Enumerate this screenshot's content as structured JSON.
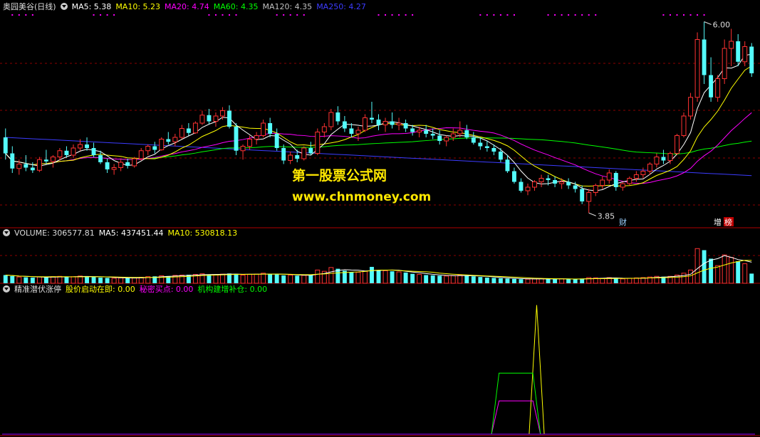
{
  "colors": {
    "bg": "#000000",
    "up": "#ff3232",
    "down": "#54fcfc",
    "ma5": "#ffffff",
    "ma10": "#ffff00",
    "ma20": "#ff00ff",
    "ma60": "#00ff00",
    "ma120": "#c0c0c0",
    "ma250": "#3c3cff",
    "grid": "#8b0000",
    "vma5": "#ffffff",
    "vma10": "#ffff00",
    "ind1": "#ffff00",
    "ind2": "#ff00ff",
    "ind3": "#00ff00"
  },
  "main": {
    "title": "奥园美谷(日线)",
    "ma": [
      {
        "text": "MA5: 5.38",
        "color": "#ffffff"
      },
      {
        "text": "MA10: 5.23",
        "color": "#ffff00"
      },
      {
        "text": "MA20: 4.74",
        "color": "#ff00ff"
      },
      {
        "text": "MA60: 4.35",
        "color": "#00ff00"
      },
      {
        "text": "MA120: 4.35",
        "color": "#c0c0c0"
      },
      {
        "text": "MA250: 4.27",
        "color": "#3c3cff"
      }
    ],
    "high_label": "6.00",
    "low_label": "3.85",
    "marker_cai": "财",
    "marker_zeng": "增",
    "marker_bang": "榜"
  },
  "volume": {
    "items": [
      {
        "text": "VOLUME: 306577.81",
        "color": "#dddddd"
      },
      {
        "text": "MA5: 437451.44",
        "color": "#ffffff"
      },
      {
        "text": "MA10: 530818.13",
        "color": "#ffff00"
      }
    ]
  },
  "indicator": {
    "name": "精准潜伏涨停",
    "items": [
      {
        "text": "股价启动在即: 0.00",
        "color": "#ffff00"
      },
      {
        "text": "秘密买点: 0.00",
        "color": "#ff00ff"
      },
      {
        "text": "机构建增补仓: 0.00",
        "color": "#00ff00"
      }
    ]
  },
  "watermark": {
    "line1": "第一股票公式网",
    "line2": "www.chnmoney.com"
  },
  "chart_data": {
    "type": "candlestick",
    "price_range": [
      3.7,
      6.1
    ],
    "ma250_start": 4.7,
    "ma250_end": 4.27,
    "ohlc": [
      [
        4.7,
        4.8,
        4.45,
        4.52
      ],
      [
        4.52,
        4.6,
        4.3,
        4.35
      ],
      [
        4.35,
        4.45,
        4.28,
        4.4
      ],
      [
        4.4,
        4.5,
        4.32,
        4.36
      ],
      [
        4.36,
        4.42,
        4.3,
        4.33
      ],
      [
        4.33,
        4.48,
        4.31,
        4.45
      ],
      [
        4.45,
        4.56,
        4.4,
        4.43
      ],
      [
        4.43,
        4.5,
        4.36,
        4.48
      ],
      [
        4.48,
        4.58,
        4.44,
        4.55
      ],
      [
        4.55,
        4.6,
        4.47,
        4.5
      ],
      [
        4.5,
        4.62,
        4.47,
        4.58
      ],
      [
        4.58,
        4.68,
        4.55,
        4.62
      ],
      [
        4.62,
        4.7,
        4.55,
        4.58
      ],
      [
        4.58,
        4.64,
        4.48,
        4.5
      ],
      [
        4.5,
        4.55,
        4.4,
        4.42
      ],
      [
        4.42,
        4.46,
        4.3,
        4.34
      ],
      [
        4.34,
        4.4,
        4.28,
        4.36
      ],
      [
        4.36,
        4.45,
        4.32,
        4.42
      ],
      [
        4.42,
        4.46,
        4.35,
        4.38
      ],
      [
        4.38,
        4.48,
        4.36,
        4.46
      ],
      [
        4.46,
        4.58,
        4.44,
        4.55
      ],
      [
        4.55,
        4.62,
        4.5,
        4.6
      ],
      [
        4.6,
        4.65,
        4.52,
        4.56
      ],
      [
        4.56,
        4.7,
        4.55,
        4.68
      ],
      [
        4.68,
        4.76,
        4.62,
        4.65
      ],
      [
        4.65,
        4.74,
        4.6,
        4.7
      ],
      [
        4.7,
        4.84,
        4.68,
        4.8
      ],
      [
        4.8,
        4.86,
        4.72,
        4.75
      ],
      [
        4.75,
        4.88,
        4.74,
        4.86
      ],
      [
        4.86,
        5.0,
        4.84,
        4.95
      ],
      [
        4.95,
        5.02,
        4.85,
        4.88
      ],
      [
        4.88,
        4.98,
        4.82,
        4.94
      ],
      [
        4.94,
        5.04,
        4.9,
        5.0
      ],
      [
        5.0,
        5.06,
        4.8,
        4.82
      ],
      [
        4.82,
        4.86,
        4.5,
        4.55
      ],
      [
        4.55,
        4.62,
        4.45,
        4.6
      ],
      [
        4.6,
        4.72,
        4.56,
        4.68
      ],
      [
        4.68,
        4.76,
        4.62,
        4.72
      ],
      [
        4.72,
        4.9,
        4.7,
        4.86
      ],
      [
        4.86,
        4.92,
        4.7,
        4.74
      ],
      [
        4.74,
        4.8,
        4.55,
        4.58
      ],
      [
        4.58,
        4.62,
        4.4,
        4.44
      ],
      [
        4.44,
        4.54,
        4.4,
        4.5
      ],
      [
        4.5,
        4.56,
        4.42,
        4.46
      ],
      [
        4.46,
        4.6,
        4.44,
        4.58
      ],
      [
        4.58,
        4.65,
        4.5,
        4.52
      ],
      [
        4.52,
        4.8,
        4.5,
        4.76
      ],
      [
        4.76,
        4.86,
        4.7,
        4.82
      ],
      [
        4.82,
        5.02,
        4.78,
        4.98
      ],
      [
        4.98,
        5.05,
        4.84,
        4.88
      ],
      [
        4.88,
        4.94,
        4.76,
        4.8
      ],
      [
        4.8,
        4.86,
        4.7,
        4.74
      ],
      [
        4.74,
        4.82,
        4.66,
        4.78
      ],
      [
        4.78,
        4.96,
        4.76,
        4.92
      ],
      [
        4.92,
        5.1,
        4.86,
        4.9
      ],
      [
        4.9,
        4.96,
        4.78,
        4.84
      ],
      [
        4.84,
        4.92,
        4.76,
        4.88
      ],
      [
        4.88,
        4.98,
        4.8,
        4.84
      ],
      [
        4.84,
        4.92,
        4.78,
        4.86
      ],
      [
        4.86,
        4.9,
        4.76,
        4.8
      ],
      [
        4.8,
        4.84,
        4.72,
        4.76
      ],
      [
        4.76,
        4.82,
        4.7,
        4.78
      ],
      [
        4.78,
        4.84,
        4.7,
        4.74
      ],
      [
        4.74,
        4.8,
        4.68,
        4.72
      ],
      [
        4.72,
        4.78,
        4.62,
        4.66
      ],
      [
        4.66,
        4.72,
        4.6,
        4.7
      ],
      [
        4.7,
        4.8,
        4.66,
        4.74
      ],
      [
        4.74,
        4.88,
        4.7,
        4.78
      ],
      [
        4.78,
        4.84,
        4.68,
        4.7
      ],
      [
        4.7,
        4.76,
        4.62,
        4.64
      ],
      [
        4.64,
        4.7,
        4.56,
        4.6
      ],
      [
        4.6,
        4.66,
        4.54,
        4.58
      ],
      [
        4.58,
        4.62,
        4.5,
        4.54
      ],
      [
        4.54,
        4.58,
        4.42,
        4.45
      ],
      [
        4.45,
        4.5,
        4.3,
        4.32
      ],
      [
        4.32,
        4.36,
        4.18,
        4.2
      ],
      [
        4.2,
        4.24,
        4.08,
        4.1
      ],
      [
        4.1,
        4.18,
        4.05,
        4.14
      ],
      [
        4.14,
        4.22,
        4.1,
        4.2
      ],
      [
        4.2,
        4.28,
        4.14,
        4.24
      ],
      [
        4.24,
        4.28,
        4.16,
        4.22
      ],
      [
        4.22,
        4.26,
        4.14,
        4.18
      ],
      [
        4.18,
        4.24,
        4.12,
        4.2
      ],
      [
        4.2,
        4.24,
        4.12,
        4.16
      ],
      [
        4.16,
        4.2,
        4.08,
        4.12
      ],
      [
        4.12,
        4.16,
        3.95,
        3.98
      ],
      [
        3.98,
        4.12,
        3.85,
        4.08
      ],
      [
        4.08,
        4.18,
        4.04,
        4.16
      ],
      [
        4.16,
        4.26,
        4.12,
        4.22
      ],
      [
        4.22,
        4.34,
        4.18,
        4.3
      ],
      [
        4.3,
        4.32,
        4.1,
        4.14
      ],
      [
        4.14,
        4.2,
        4.1,
        4.18
      ],
      [
        4.18,
        4.26,
        4.16,
        4.24
      ],
      [
        4.24,
        4.32,
        4.2,
        4.28
      ],
      [
        4.28,
        4.36,
        4.24,
        4.32
      ],
      [
        4.32,
        4.42,
        4.28,
        4.4
      ],
      [
        4.4,
        4.52,
        4.36,
        4.48
      ],
      [
        4.48,
        4.56,
        4.4,
        4.44
      ],
      [
        4.44,
        4.54,
        4.4,
        4.52
      ],
      [
        4.52,
        4.74,
        4.5,
        4.72
      ],
      [
        4.72,
        4.98,
        4.7,
        4.94
      ],
      [
        4.94,
        5.2,
        4.9,
        5.15
      ],
      [
        5.15,
        5.88,
        5.1,
        5.8
      ],
      [
        5.8,
        6.0,
        5.3,
        5.4
      ],
      [
        5.4,
        5.6,
        5.1,
        5.15
      ],
      [
        5.15,
        5.4,
        5.1,
        5.36
      ],
      [
        5.36,
        5.8,
        5.3,
        5.7
      ],
      [
        5.7,
        5.92,
        5.5,
        5.78
      ],
      [
        5.78,
        5.86,
        5.5,
        5.55
      ],
      [
        5.55,
        5.78,
        5.5,
        5.72
      ],
      [
        5.72,
        5.76,
        5.38,
        5.42
      ]
    ],
    "volume_range": [
      0,
      1400000
    ],
    "volume": [
      260000,
      230000,
      200000,
      190000,
      180000,
      200000,
      190000,
      210000,
      220000,
      200000,
      210000,
      230000,
      220000,
      200000,
      180000,
      170000,
      160000,
      170000,
      160000,
      170000,
      190000,
      210000,
      220000,
      240000,
      230000,
      250000,
      260000,
      270000,
      280000,
      300000,
      280000,
      270000,
      290000,
      310000,
      300000,
      260000,
      280000,
      290000,
      320000,
      300000,
      280000,
      250000,
      260000,
      240000,
      250000,
      260000,
      420000,
      380000,
      500000,
      460000,
      400000,
      360000,
      350000,
      380000,
      520000,
      420000,
      400000,
      380000,
      360000,
      340000,
      300000,
      280000,
      260000,
      250000,
      240000,
      230000,
      240000,
      260000,
      240000,
      220000,
      200000,
      180000,
      170000,
      160000,
      150000,
      140000,
      130000,
      130000,
      140000,
      150000,
      140000,
      130000,
      140000,
      130000,
      130000,
      150000,
      180000,
      170000,
      160000,
      180000,
      150000,
      140000,
      160000,
      170000,
      180000,
      200000,
      220000,
      210000,
      220000,
      260000,
      320000,
      420000,
      1100000,
      1050000,
      780000,
      560000,
      900000,
      820000,
      700000,
      620000,
      306577
    ],
    "indicator_range": [
      0,
      1
    ],
    "indicator_series": [
      {
        "name": "股价启动在即",
        "color": "#ffff00",
        "points": [
          [
            0,
            0
          ],
          [
            0.62,
            0
          ],
          [
            0.66,
            0
          ],
          [
            0.7,
            0
          ],
          [
            0.71,
            0.93
          ],
          [
            0.72,
            0
          ]
        ]
      },
      {
        "name": "秘密买点",
        "color": "#ff00ff",
        "points": [
          [
            0,
            0
          ],
          [
            0.65,
            0
          ],
          [
            0.66,
            0.24
          ],
          [
            0.705,
            0.24
          ],
          [
            0.715,
            0
          ],
          [
            1,
            0
          ]
        ]
      },
      {
        "name": "机构建增补仓",
        "color": "#00ff00",
        "points": [
          [
            0,
            0
          ],
          [
            0.65,
            0
          ],
          [
            0.66,
            0.44
          ],
          [
            0.705,
            0.44
          ],
          [
            0.715,
            0
          ],
          [
            1,
            0
          ]
        ]
      }
    ]
  }
}
